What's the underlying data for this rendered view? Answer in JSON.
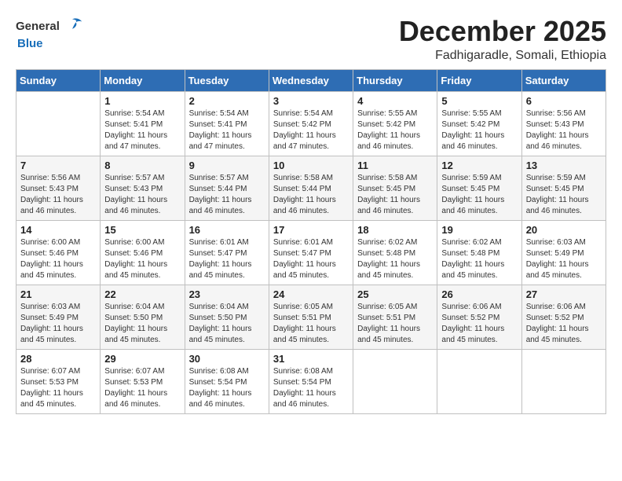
{
  "logo": {
    "general": "General",
    "blue": "Blue"
  },
  "title": "December 2025",
  "subtitle": "Fadhigaradle, Somali, Ethiopia",
  "days_header": [
    "Sunday",
    "Monday",
    "Tuesday",
    "Wednesday",
    "Thursday",
    "Friday",
    "Saturday"
  ],
  "weeks": [
    [
      {
        "day": "",
        "info": ""
      },
      {
        "day": "1",
        "info": "Sunrise: 5:54 AM\nSunset: 5:41 PM\nDaylight: 11 hours\nand 47 minutes."
      },
      {
        "day": "2",
        "info": "Sunrise: 5:54 AM\nSunset: 5:41 PM\nDaylight: 11 hours\nand 47 minutes."
      },
      {
        "day": "3",
        "info": "Sunrise: 5:54 AM\nSunset: 5:42 PM\nDaylight: 11 hours\nand 47 minutes."
      },
      {
        "day": "4",
        "info": "Sunrise: 5:55 AM\nSunset: 5:42 PM\nDaylight: 11 hours\nand 46 minutes."
      },
      {
        "day": "5",
        "info": "Sunrise: 5:55 AM\nSunset: 5:42 PM\nDaylight: 11 hours\nand 46 minutes."
      },
      {
        "day": "6",
        "info": "Sunrise: 5:56 AM\nSunset: 5:43 PM\nDaylight: 11 hours\nand 46 minutes."
      }
    ],
    [
      {
        "day": "7",
        "info": "Sunrise: 5:56 AM\nSunset: 5:43 PM\nDaylight: 11 hours\nand 46 minutes."
      },
      {
        "day": "8",
        "info": "Sunrise: 5:57 AM\nSunset: 5:43 PM\nDaylight: 11 hours\nand 46 minutes."
      },
      {
        "day": "9",
        "info": "Sunrise: 5:57 AM\nSunset: 5:44 PM\nDaylight: 11 hours\nand 46 minutes."
      },
      {
        "day": "10",
        "info": "Sunrise: 5:58 AM\nSunset: 5:44 PM\nDaylight: 11 hours\nand 46 minutes."
      },
      {
        "day": "11",
        "info": "Sunrise: 5:58 AM\nSunset: 5:45 PM\nDaylight: 11 hours\nand 46 minutes."
      },
      {
        "day": "12",
        "info": "Sunrise: 5:59 AM\nSunset: 5:45 PM\nDaylight: 11 hours\nand 46 minutes."
      },
      {
        "day": "13",
        "info": "Sunrise: 5:59 AM\nSunset: 5:45 PM\nDaylight: 11 hours\nand 46 minutes."
      }
    ],
    [
      {
        "day": "14",
        "info": "Sunrise: 6:00 AM\nSunset: 5:46 PM\nDaylight: 11 hours\nand 45 minutes."
      },
      {
        "day": "15",
        "info": "Sunrise: 6:00 AM\nSunset: 5:46 PM\nDaylight: 11 hours\nand 45 minutes."
      },
      {
        "day": "16",
        "info": "Sunrise: 6:01 AM\nSunset: 5:47 PM\nDaylight: 11 hours\nand 45 minutes."
      },
      {
        "day": "17",
        "info": "Sunrise: 6:01 AM\nSunset: 5:47 PM\nDaylight: 11 hours\nand 45 minutes."
      },
      {
        "day": "18",
        "info": "Sunrise: 6:02 AM\nSunset: 5:48 PM\nDaylight: 11 hours\nand 45 minutes."
      },
      {
        "day": "19",
        "info": "Sunrise: 6:02 AM\nSunset: 5:48 PM\nDaylight: 11 hours\nand 45 minutes."
      },
      {
        "day": "20",
        "info": "Sunrise: 6:03 AM\nSunset: 5:49 PM\nDaylight: 11 hours\nand 45 minutes."
      }
    ],
    [
      {
        "day": "21",
        "info": "Sunrise: 6:03 AM\nSunset: 5:49 PM\nDaylight: 11 hours\nand 45 minutes."
      },
      {
        "day": "22",
        "info": "Sunrise: 6:04 AM\nSunset: 5:50 PM\nDaylight: 11 hours\nand 45 minutes."
      },
      {
        "day": "23",
        "info": "Sunrise: 6:04 AM\nSunset: 5:50 PM\nDaylight: 11 hours\nand 45 minutes."
      },
      {
        "day": "24",
        "info": "Sunrise: 6:05 AM\nSunset: 5:51 PM\nDaylight: 11 hours\nand 45 minutes."
      },
      {
        "day": "25",
        "info": "Sunrise: 6:05 AM\nSunset: 5:51 PM\nDaylight: 11 hours\nand 45 minutes."
      },
      {
        "day": "26",
        "info": "Sunrise: 6:06 AM\nSunset: 5:52 PM\nDaylight: 11 hours\nand 45 minutes."
      },
      {
        "day": "27",
        "info": "Sunrise: 6:06 AM\nSunset: 5:52 PM\nDaylight: 11 hours\nand 45 minutes."
      }
    ],
    [
      {
        "day": "28",
        "info": "Sunrise: 6:07 AM\nSunset: 5:53 PM\nDaylight: 11 hours\nand 45 minutes."
      },
      {
        "day": "29",
        "info": "Sunrise: 6:07 AM\nSunset: 5:53 PM\nDaylight: 11 hours\nand 46 minutes."
      },
      {
        "day": "30",
        "info": "Sunrise: 6:08 AM\nSunset: 5:54 PM\nDaylight: 11 hours\nand 46 minutes."
      },
      {
        "day": "31",
        "info": "Sunrise: 6:08 AM\nSunset: 5:54 PM\nDaylight: 11 hours\nand 46 minutes."
      },
      {
        "day": "",
        "info": ""
      },
      {
        "day": "",
        "info": ""
      },
      {
        "day": "",
        "info": ""
      }
    ]
  ]
}
